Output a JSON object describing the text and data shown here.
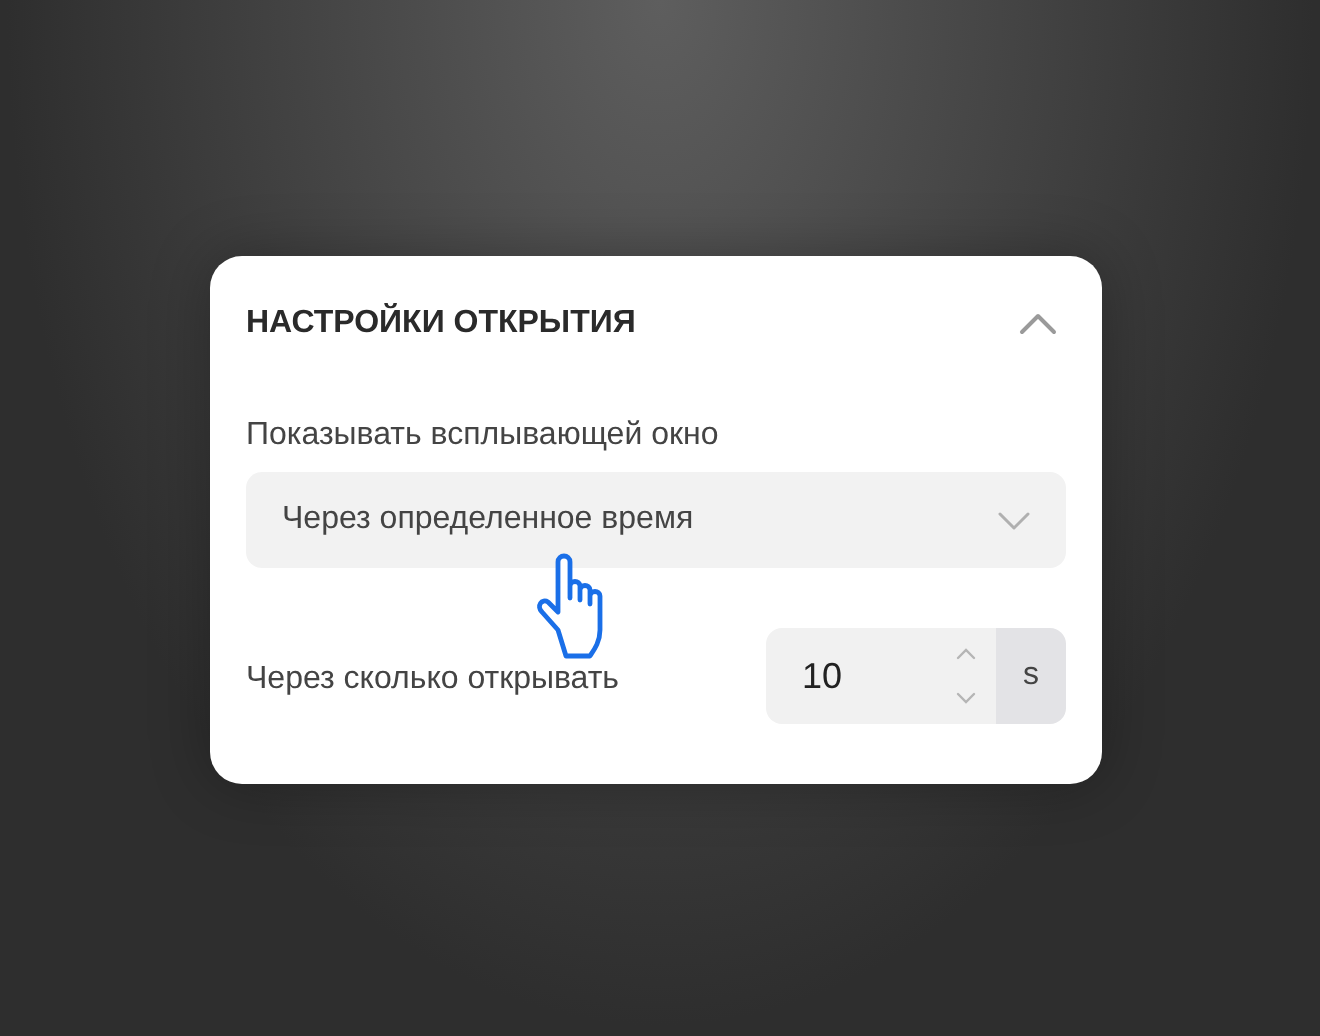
{
  "panel": {
    "title": "НАСТРОЙКИ ОТКРЫТИЯ",
    "expanded": true
  },
  "popup_mode": {
    "label": "Показывать всплывающей окно",
    "value": "Через определенное время"
  },
  "open_delay": {
    "label": "Через сколько открывать",
    "value": "10",
    "unit": "s"
  }
}
